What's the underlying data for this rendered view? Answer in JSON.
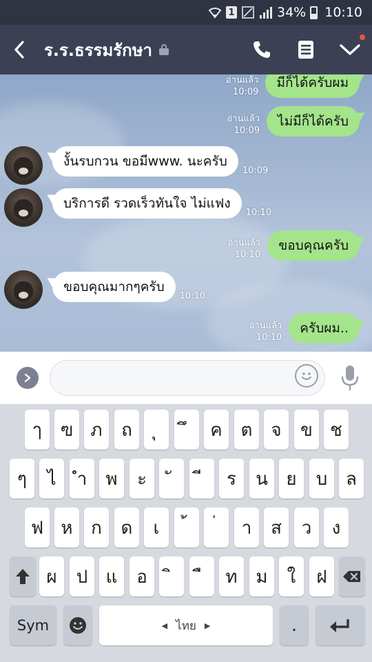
{
  "status_bar": {
    "battery": "34%",
    "time": "10:10",
    "sim": "1"
  },
  "header": {
    "title": "ร.ร.ธรรมรักษา"
  },
  "messages": [
    {
      "dir": "out",
      "text": "มีก็ได้ครับผม",
      "read": "อ่านแล้ว",
      "time": "10:09"
    },
    {
      "dir": "out",
      "text": "ไม่มีก็ได้ครับ",
      "read": "อ่านแล้ว",
      "time": "10:09"
    },
    {
      "dir": "in",
      "text": "งั้นรบกวน ขอมีwww. นะครับ",
      "time": "10:09"
    },
    {
      "dir": "in",
      "text": "บริการดี รวดเร็วทันใจ ไม่แฟง",
      "time": "10:10"
    },
    {
      "dir": "out",
      "text": "ขอบคุณครับ",
      "read": "อ่านแล้ว",
      "time": "10:10"
    },
    {
      "dir": "in",
      "text": "ขอบคุณมากๆครับ",
      "time": "10:10"
    },
    {
      "dir": "out",
      "text": "ครับผม..",
      "read": "อ่านแล้ว",
      "time": "10:10"
    }
  ],
  "input": {
    "placeholder": ""
  },
  "keyboard": {
    "row1": [
      "ๅ",
      "ฃ",
      "ภ",
      "ถ",
      "ุ",
      "ึ",
      "ค",
      "ต",
      "จ",
      "ข",
      "ช"
    ],
    "row2": [
      "ๆ",
      "ไ",
      "ำ",
      "พ",
      "ะ",
      "ั",
      "ี",
      "ร",
      "น",
      "ย",
      "บ",
      "ล"
    ],
    "row3": [
      "ฟ",
      "ห",
      "ก",
      "ด",
      "เ",
      "้",
      "่",
      "า",
      "ส",
      "ว",
      "ง"
    ],
    "row4": [
      "ผ",
      "ป",
      "แ",
      "อ",
      "ิ",
      "ื",
      "ท",
      "ม",
      "ใ",
      "ฝ"
    ],
    "sym_label": "Sym",
    "space_label": "ไทย",
    "period_label": "."
  }
}
